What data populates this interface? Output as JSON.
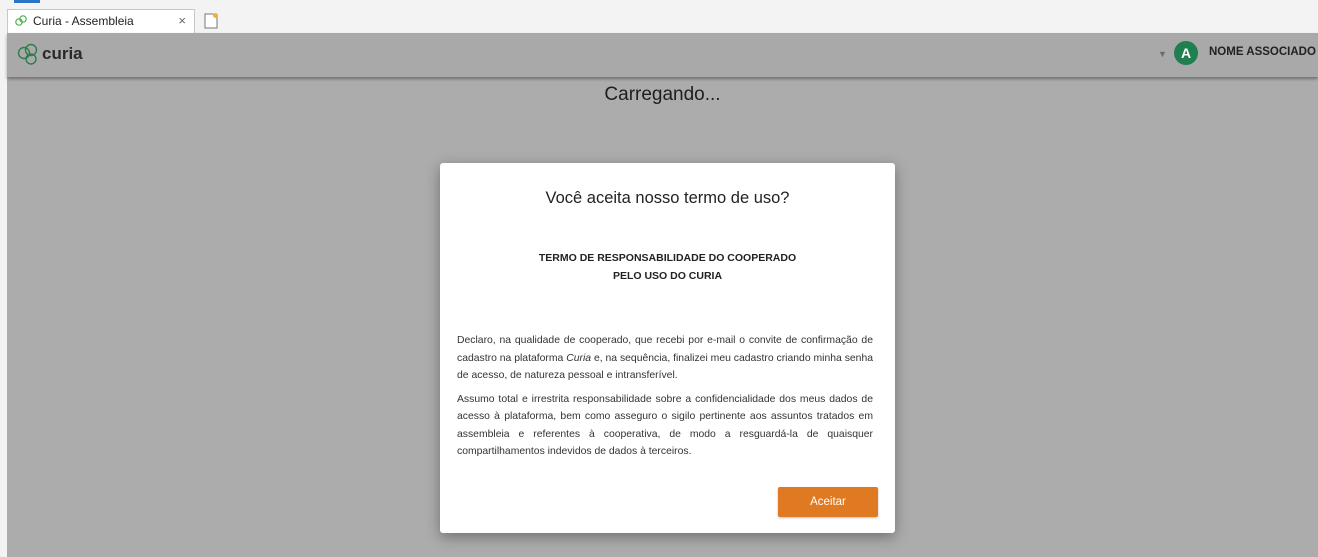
{
  "browser": {
    "tab_title": "Curia - Assembleia",
    "close_glyph": "×"
  },
  "header": {
    "logo_text": "curia",
    "user_initial": "A",
    "user_name": "NOME ASSOCIADO",
    "caret_glyph": "▼"
  },
  "main": {
    "loading_text": "Carregando..."
  },
  "modal": {
    "title": "Você aceita nosso termo de uso?",
    "doc_title_line1": "TERMO DE RESPONSABILIDADE DO COOPERADO",
    "doc_title_line2": "PELO USO DO CURIA",
    "p1_before": "Declaro, na qualidade de cooperado, que recebi por e-mail o convite de confirmação de cadastro na plataforma ",
    "p1_italic": "Curia",
    "p1_after": " e, na sequência, finalizei meu cadastro criando minha senha de acesso, de natureza pessoal e intransferível.",
    "p2": "Assumo total e irrestrita responsabilidade sobre a confidencialidade dos meus dados de acesso à plataforma, bem como asseguro o sigilo pertinente aos assuntos tratados em assembleia e referentes à cooperativa, de modo a resguardá-la de quaisquer compartilhamentos indevidos de dados à terceiros.",
    "accept_label": "Aceitar"
  },
  "colors": {
    "accent_orange": "#e07a22",
    "avatar_green": "#1f7f4f",
    "header_gray": "#a9a9a9",
    "overlay_gray": "#acacac"
  },
  "icons": {
    "favicon": "curia-logo-icon",
    "tab_close": "close-icon",
    "new_tab": "new-tab-icon",
    "dropdown": "chevron-down-icon"
  }
}
